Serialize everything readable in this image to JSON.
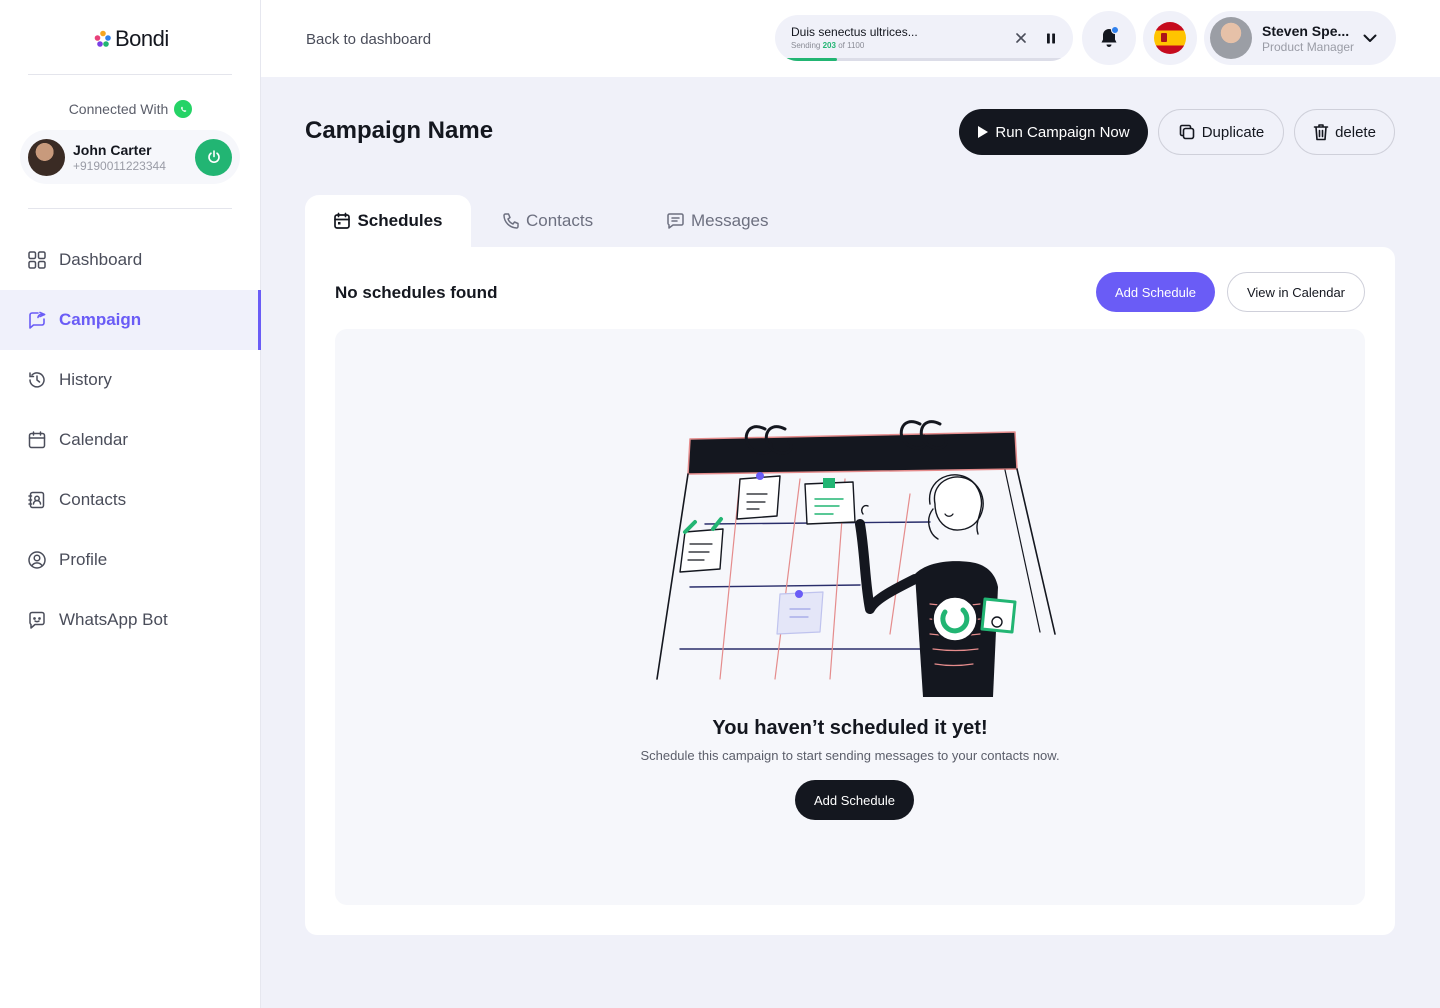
{
  "app": {
    "brand": "Bondi"
  },
  "sidebar": {
    "connected_label": "Connected With",
    "account": {
      "name": "John Carter",
      "phone": "+9190011223344"
    },
    "items": [
      {
        "label": "Dashboard",
        "icon": "grid-icon",
        "active": false
      },
      {
        "label": "Campaign",
        "icon": "campaign-icon",
        "active": true
      },
      {
        "label": "History",
        "icon": "history-icon",
        "active": false
      },
      {
        "label": "Calendar",
        "icon": "calendar-icon",
        "active": false
      },
      {
        "label": "Contacts",
        "icon": "contacts-book-icon",
        "active": false
      },
      {
        "label": "Profile",
        "icon": "user-circle-icon",
        "active": false
      },
      {
        "label": "WhatsApp Bot",
        "icon": "chat-bot-icon",
        "active": false
      }
    ]
  },
  "topbar": {
    "back_label": "Back to dashboard",
    "sending": {
      "title": "Duis senectus ultrices...",
      "prefix": "Sending",
      "sent": "203",
      "of": "of",
      "total": "1100",
      "progress": 0.1845
    },
    "user": {
      "name": "Steven Spe...",
      "role": "Product Manager"
    }
  },
  "header": {
    "title": "Campaign Name",
    "run_label": "Run Campaign Now",
    "duplicate_label": "Duplicate",
    "delete_label": "delete"
  },
  "tabs": [
    {
      "label": "Schedules",
      "active": true
    },
    {
      "label": "Contacts",
      "active": false
    },
    {
      "label": "Messages",
      "active": false
    }
  ],
  "schedules": {
    "heading": "No schedules found",
    "add_label": "Add Schedule",
    "calendar_label": "View in Calendar",
    "empty_title": "You haven’t scheduled it yet!",
    "empty_sub": "Schedule this campaign to start sending messages to your contacts now.",
    "empty_cta": "Add Schedule"
  },
  "colors": {
    "accent": "#6A5CF6",
    "dark": "#14171F",
    "success": "#22B573",
    "background": "#F0F1F9"
  }
}
